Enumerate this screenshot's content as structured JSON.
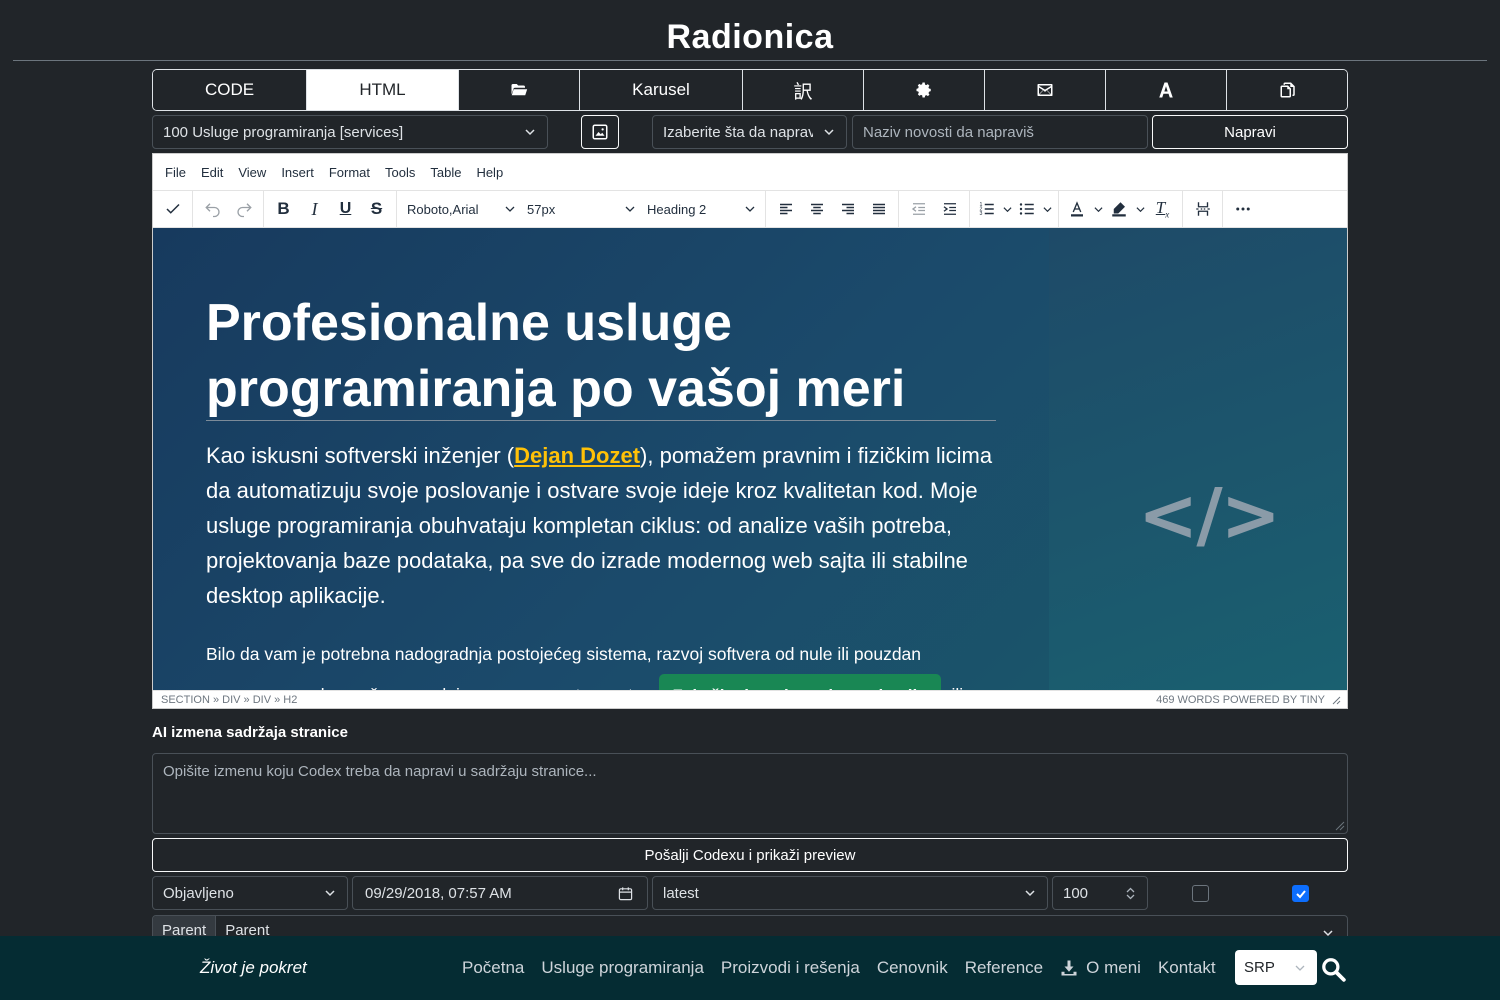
{
  "header": {
    "title": "Radionica"
  },
  "tabs": [
    {
      "label": "CODE",
      "active": false
    },
    {
      "label": "HTML",
      "active": true
    },
    {
      "icon": "folder-open-icon"
    },
    {
      "label": "Karusel"
    },
    {
      "label": "訳",
      "icon": "translate-icon"
    },
    {
      "icon": "gear-icon"
    },
    {
      "icon": "envelope-icon"
    },
    {
      "icon": "font-icon"
    },
    {
      "icon": "copy-icon"
    }
  ],
  "controls": {
    "page_select": "100 Usluge programiranja [services]",
    "image_button_icon": "image-icon",
    "type_select_placeholder": "Izaberite šta da napraviš",
    "news_input_placeholder": "Naziv novosti da napraviš",
    "create_button": "Napravi"
  },
  "editor": {
    "menu": [
      "File",
      "Edit",
      "View",
      "Insert",
      "Format",
      "Tools",
      "Table",
      "Help"
    ],
    "font_family": "Roboto,Arial",
    "font_size": "57px",
    "block_format": "Heading 2",
    "hero_title": "Profesionalne usluge programiranja po vašoj meri",
    "para1_before": "Kao iskusni softverski inženjer (",
    "para1_link": "Dejan Dozet",
    "para1_after": "), pomažem pravnim i fizičkim licima da automatizuju svoje poslovanje i ostvare svoje ideje kroz kvalitetan kod. Moje usluge programiranja obuhvataju kompletan ciklus: od analize vaših potreba, projektovanja baze podataka, pa sve do izrade modernog web sajta ili stabilne desktop aplikacije.",
    "para2_before": "Bilo da vam je potrebna nadogradnja postojećeg sistema, razvoj softvera od nule ili pouzdan programer za dugoročnu saradnju, na pravom ste mestu.",
    "para2_cta": "Zakažite besplatne konsultacije",
    "para2_after": "ili",
    "code_glyph": "</>",
    "status_path": "SECTION » DIV » DIV » H2",
    "status_right": "469 WORDS  POWERED BY TINY"
  },
  "ai": {
    "label": "AI izmena sadržaja stranice",
    "placeholder": "Opišite izmenu koju Codex treba da napravi u sadržaju stranice...",
    "submit": "Pošalji Codexu i prikaži preview"
  },
  "meta_row": {
    "status": "Objavljeno",
    "datetime": "09/29/2018, 07:57 AM",
    "version": "latest",
    "order": "100",
    "checkbox1": false,
    "checkbox2": true
  },
  "parent": {
    "addon": "Parent",
    "value": "Parent"
  },
  "footer": {
    "brand": "Život je pokret",
    "links": [
      "Početna",
      "Usluge programiranja",
      "Proizvodi i rešenja",
      "Cenovnik",
      "Reference",
      "O meni",
      "Kontakt"
    ],
    "language": "SRP"
  },
  "colors": {
    "background": "#212529",
    "footer": "#052c33",
    "accent_link": "#ffc107",
    "cta": "#198754",
    "checkbox_on": "#0d6efd"
  }
}
